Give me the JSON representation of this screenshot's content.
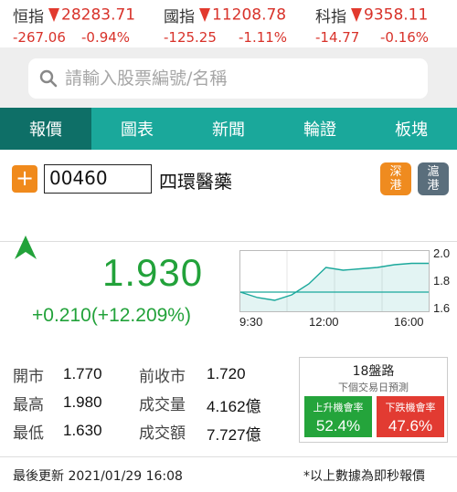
{
  "indices": [
    {
      "name": "恒指",
      "value": "28283.71",
      "change": "-267.06",
      "pct": "-0.94%"
    },
    {
      "name": "國指",
      "value": "11208.78",
      "change": "-125.25",
      "pct": "-1.11%"
    },
    {
      "name": "科指",
      "value": "9358.11",
      "change": "-14.77",
      "pct": "-0.16%"
    }
  ],
  "search": {
    "placeholder": "請輸入股票編號/名稱"
  },
  "tabs": [
    "報價",
    "圖表",
    "新聞",
    "輪證",
    "板塊"
  ],
  "stock": {
    "add_label": "+",
    "code": "00460",
    "name": "四環醫藥",
    "market_sz": "深港",
    "market_hk": "滬港",
    "price": "1.930",
    "change": "+0.210(+12.209%)"
  },
  "mini_chart": {
    "y_ticks": [
      "2.0",
      "1.8",
      "1.6"
    ],
    "x_ticks": [
      "9:30",
      "12:00",
      "16:00"
    ]
  },
  "chart_data": {
    "type": "line",
    "x": [
      "9:30",
      "10:00",
      "10:30",
      "11:00",
      "11:30",
      "12:00",
      "13:30",
      "14:00",
      "14:30",
      "15:00",
      "15:30",
      "16:00"
    ],
    "values": [
      1.72,
      1.68,
      1.66,
      1.7,
      1.78,
      1.9,
      1.88,
      1.89,
      1.9,
      1.92,
      1.93,
      1.93
    ],
    "reference": 1.72,
    "ylim": [
      1.6,
      2.0
    ],
    "line_color": "#1aa89b"
  },
  "stats": {
    "open_label": "開市",
    "open": "1.770",
    "high_label": "最高",
    "high": "1.980",
    "low_label": "最低",
    "low": "1.630",
    "prev_label": "前收市",
    "prev": "1.720",
    "volume_label": "成交量",
    "volume": "4.162億",
    "turnover_label": "成交額",
    "turnover": "7.727億"
  },
  "forecast": {
    "title": "18盤路",
    "subtitle": "下個交易日預測",
    "up_label": "上升機會率",
    "up_value": "52.4%",
    "down_label": "下跌機會率",
    "down_value": "47.6%"
  },
  "footer": {
    "updated": "最後更新 2021/01/29 16:08",
    "note": "*以上數據為即秒報價"
  },
  "colors": {
    "up": "#22a23a",
    "down": "#d8322a",
    "tab_bg": "#1aa89b",
    "tab_active": "#0e6f67"
  }
}
